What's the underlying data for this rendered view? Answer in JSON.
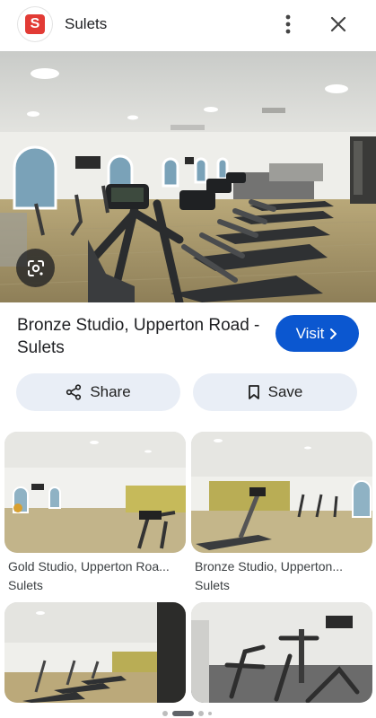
{
  "header": {
    "logo_letter": "S",
    "site_name": "Sulets",
    "more_icon": "more-vert-icon",
    "close_icon": "close-icon"
  },
  "hero": {
    "lens_icon": "lens-icon"
  },
  "result": {
    "title": "Bronze Studio, Upperton Road - Sulets",
    "visit_label": "Visit",
    "visit_icon": "chevron-right-icon"
  },
  "actions": {
    "share_label": "Share",
    "share_icon": "share-icon",
    "save_label": "Save",
    "save_icon": "bookmark-icon"
  },
  "related": [
    {
      "caption": "Gold Studio, Upperton Roa...",
      "source": "Sulets"
    },
    {
      "caption": "Bronze Studio, Upperton...",
      "source": "Sulets"
    },
    {
      "caption": "",
      "source": ""
    },
    {
      "caption": "",
      "source": ""
    }
  ],
  "pager": {
    "count": 4,
    "active": 1
  },
  "colors": {
    "accent": "#0b57d0",
    "pill_bg": "#e9eef6",
    "logo_red": "#e23b35"
  }
}
